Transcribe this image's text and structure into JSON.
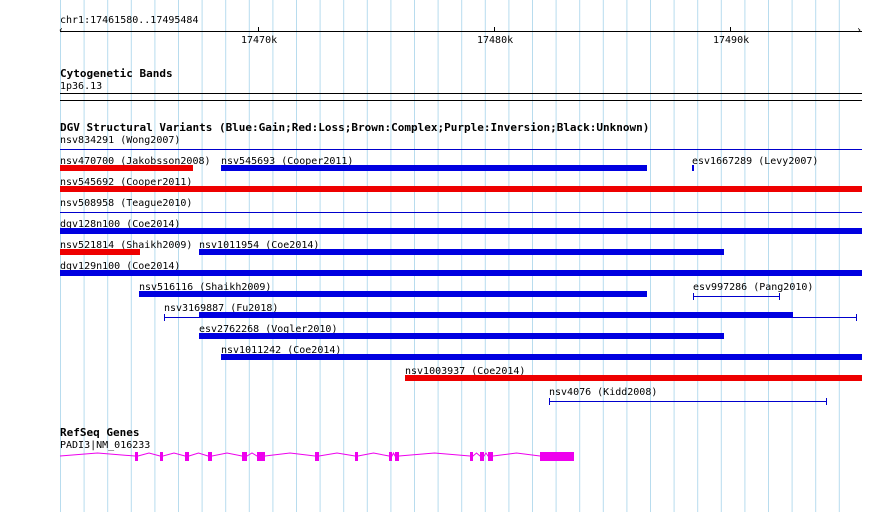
{
  "ruler": {
    "region": "chr1:17461580..17495484",
    "ticks": [
      "17470k",
      "17480k",
      "17490k"
    ]
  },
  "cytoband": {
    "title": "Cytogenetic Bands",
    "band": "1p36.13"
  },
  "dgv": {
    "title": "DGV Structural Variants (Blue:Gain;Red:Loss;Brown:Complex;Purple:Inversion;Black:Unknown)",
    "colors": {
      "gain": "#0000e0",
      "loss": "#ee0000",
      "thin": "#0000cc"
    },
    "variants": [
      {
        "id": "nsv834291",
        "label": "nsv834291 (Wong2007)"
      },
      {
        "id": "nsv470700",
        "label": "nsv470700 (Jakobsson2008)"
      },
      {
        "id": "nsv545693",
        "label": "nsv545693 (Cooper2011)"
      },
      {
        "id": "esv1667289",
        "label": "esv1667289 (Levy2007)"
      },
      {
        "id": "nsv545692",
        "label": "nsv545692 (Cooper2011)"
      },
      {
        "id": "nsv508958",
        "label": "nsv508958 (Teague2010)"
      },
      {
        "id": "dgv128n100",
        "label": "dgv128n100 (Coe2014)"
      },
      {
        "id": "nsv521814",
        "label": "nsv521814 (Shaikh2009)"
      },
      {
        "id": "nsv1011954",
        "label": "nsv1011954 (Coe2014)"
      },
      {
        "id": "dgv129n100",
        "label": "dgv129n100 (Coe2014)"
      },
      {
        "id": "nsv516116",
        "label": "nsv516116 (Shaikh2009)"
      },
      {
        "id": "esv997286",
        "label": "esv997286 (Pang2010)"
      },
      {
        "id": "nsv3169887",
        "label": "nsv3169887 (Fu2018)"
      },
      {
        "id": "esv2762268",
        "label": "esv2762268 (Vogler2010)"
      },
      {
        "id": "nsv1011242",
        "label": "nsv1011242 (Coe2014)"
      },
      {
        "id": "nsv1003937",
        "label": "nsv1003937 (Coe2014)"
      },
      {
        "id": "nsv4076",
        "label": "nsv4076 (Kidd2008)"
      }
    ]
  },
  "refseq": {
    "title": "RefSeq Genes",
    "gene": "PADI3|NM_016233",
    "color": "#ee00ee"
  },
  "grid_color": "#b8dcee"
}
